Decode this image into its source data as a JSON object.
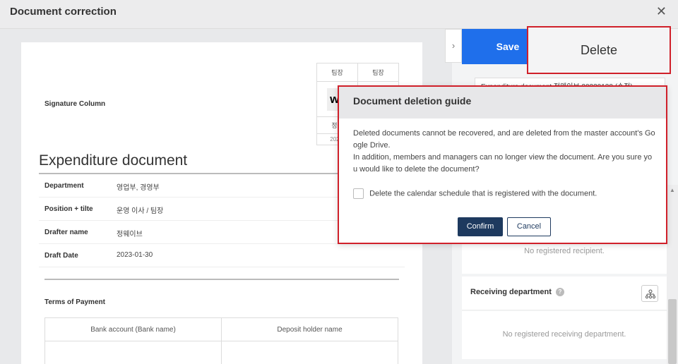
{
  "header": {
    "title": "Document correction",
    "close_icon": "close-icon"
  },
  "document": {
    "signature_label": "Signature Column",
    "signature": {
      "headers": [
        "팀장",
        "팀장"
      ],
      "sig_text": "wa",
      "signer_name": "정웨",
      "date_partial": "2023-"
    },
    "title": "Expenditure document",
    "fields": [
      {
        "label": "Department",
        "value": "영업부, 경영부"
      },
      {
        "label": "Position + tilte",
        "value": "운영 이사 / 팀장"
      },
      {
        "label": "Drafter name",
        "value": "정웨이브"
      },
      {
        "label": "Draft Date",
        "value": "2023-01-30"
      }
    ],
    "terms_label": "Terms of Payment",
    "bank_table": {
      "headers": [
        "Bank account (Bank name)",
        "Deposit holder name"
      ]
    }
  },
  "panel": {
    "save_label": "Save",
    "delete_label": "Delete",
    "doc_name_value": "Expenditure document 정웨이브 20230130 (수정)",
    "no_recipient": "No registered recipient.",
    "receiving_dept_title": "Receiving department",
    "no_receiving_dept": "No registered receiving department."
  },
  "modal": {
    "title": "Document deletion guide",
    "body_line1": "Deleted documents cannot be recovered, and are deleted from the master account's Google Drive.",
    "body_line2": "In addition, members and managers can no longer view the document. Are you sure you would like to delete the document?",
    "checkbox_label": "Delete the calendar schedule that is registered with the document.",
    "confirm_label": "Confirm",
    "cancel_label": "Cancel"
  },
  "colors": {
    "accent_blue": "#1f6feb",
    "highlight_red": "#d0202a",
    "confirm_navy": "#1e3a5f"
  }
}
